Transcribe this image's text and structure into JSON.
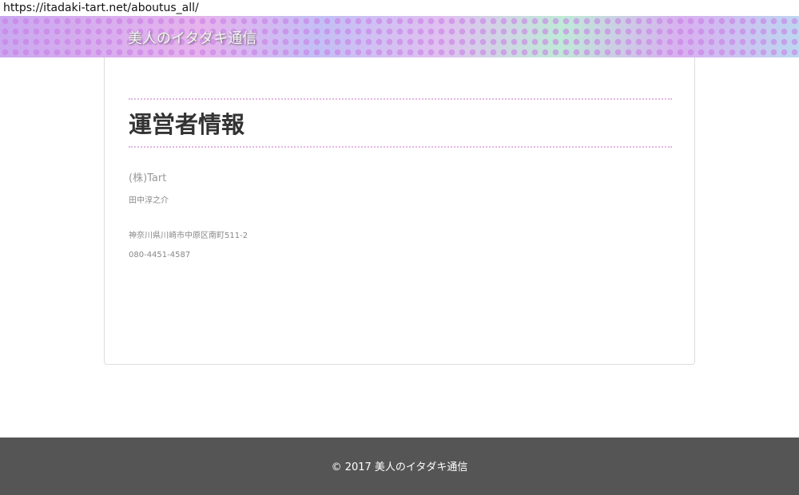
{
  "browser": {
    "url": "https://itadaki-tart.net/aboutus_all/"
  },
  "header": {
    "site_title": "美人のイタダキ通信"
  },
  "main": {
    "title": "運営者情報",
    "company": "(株)Tart",
    "person": "田中淳之介",
    "address": "神奈川県川崎市中原区南町511-2",
    "phone": "080-4451-4587"
  },
  "footer": {
    "copyright": "© 2017 美人のイタダキ通信"
  }
}
